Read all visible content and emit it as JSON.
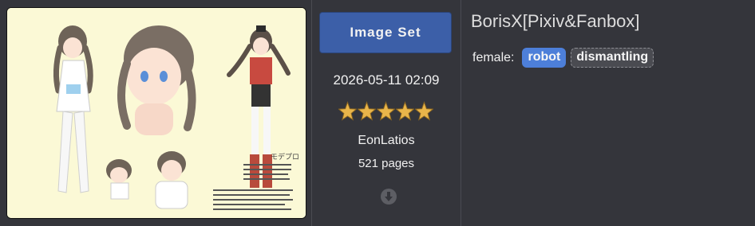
{
  "gallery": {
    "category_label": "Image Set",
    "posted": "2026-05-11 02:09",
    "rating": 5,
    "uploader": "EonLatios",
    "pages": "521 pages",
    "title": "BorisX[Pixiv&Fanbox]",
    "tags": {
      "namespace": "female:",
      "items": [
        {
          "label": "robot",
          "style": "watched"
        },
        {
          "label": "dismantling",
          "style": "plain"
        }
      ]
    }
  },
  "thumbnail": {
    "sheet_label": "モデプロ",
    "sheet_caption_lines": [
      "女性として、全身と頭部を個別に作成"
    ],
    "background_color": "#fbf9d6"
  },
  "colors": {
    "category": "#3c5fa8",
    "tag_watched": "#4d7fd9",
    "star": "#e9b54a"
  },
  "icons": {
    "rating": "star-icon",
    "download": "download-arrow-icon"
  }
}
